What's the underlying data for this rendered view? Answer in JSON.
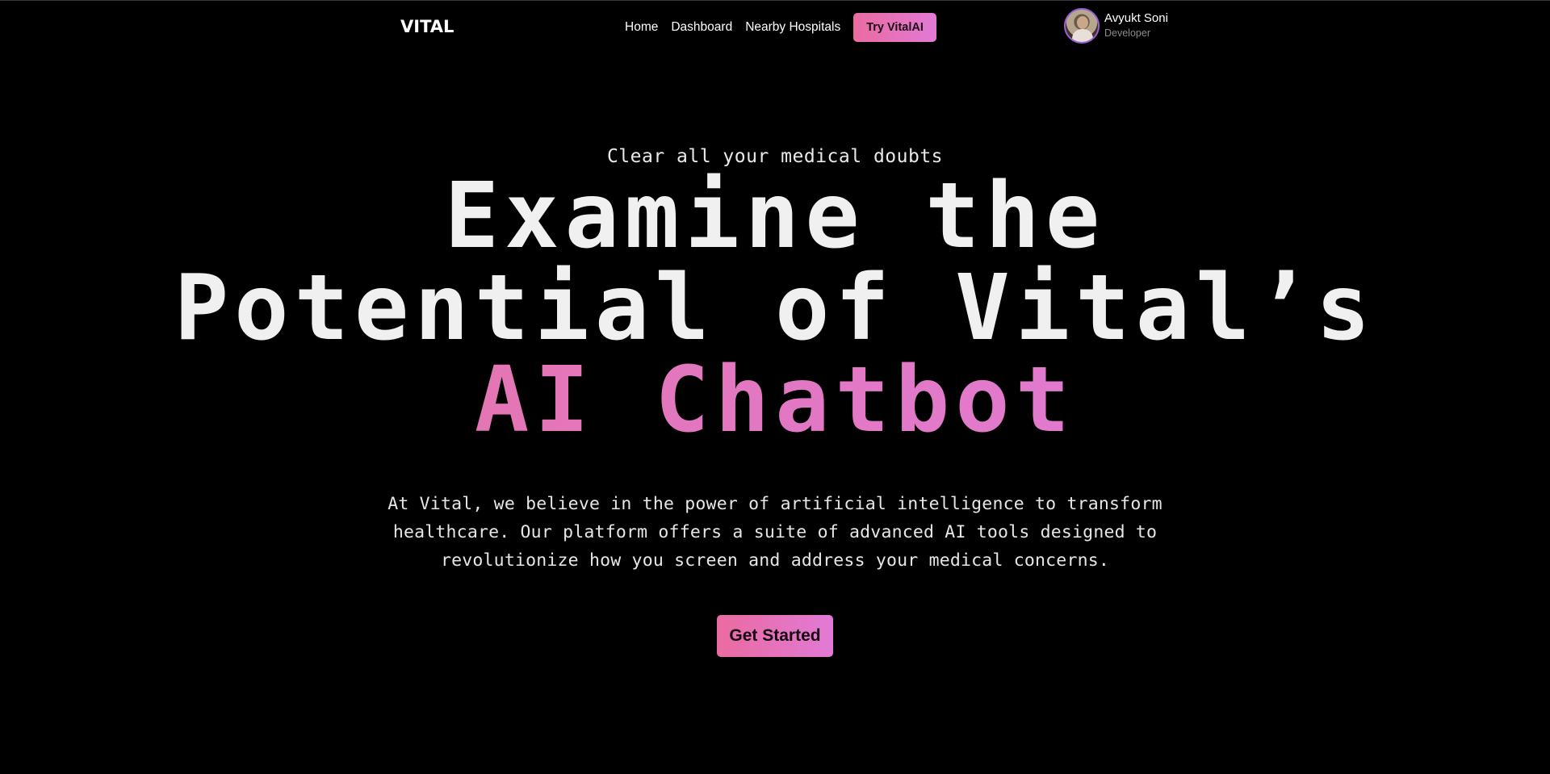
{
  "navbar": {
    "brand": "VITAL",
    "links": [
      "Home",
      "Dashboard",
      "Nearby Hospitals"
    ],
    "try_button": "Try VitalAI"
  },
  "profile": {
    "name": "Avyukt Soni",
    "role": "Developer"
  },
  "hero": {
    "eyebrow": "Clear all your medical doubts",
    "headline_line1": "Examine the",
    "headline_line2": "Potential of Vital’s",
    "headline_line3": "AI Chatbot",
    "description": "At Vital, we believe in the power of artificial intelligence to transform healthcare. Our platform offers a suite of advanced AI tools designed to revolutionize how you screen and address your medical concerns.",
    "cta": "Get Started"
  },
  "colors": {
    "background": "#000000",
    "accent_start": "#ea6ba0",
    "accent_end": "#e27ad6",
    "avatar_ring": "#9a5fd6"
  },
  "icons": {
    "avatar": "user-avatar-photo"
  }
}
